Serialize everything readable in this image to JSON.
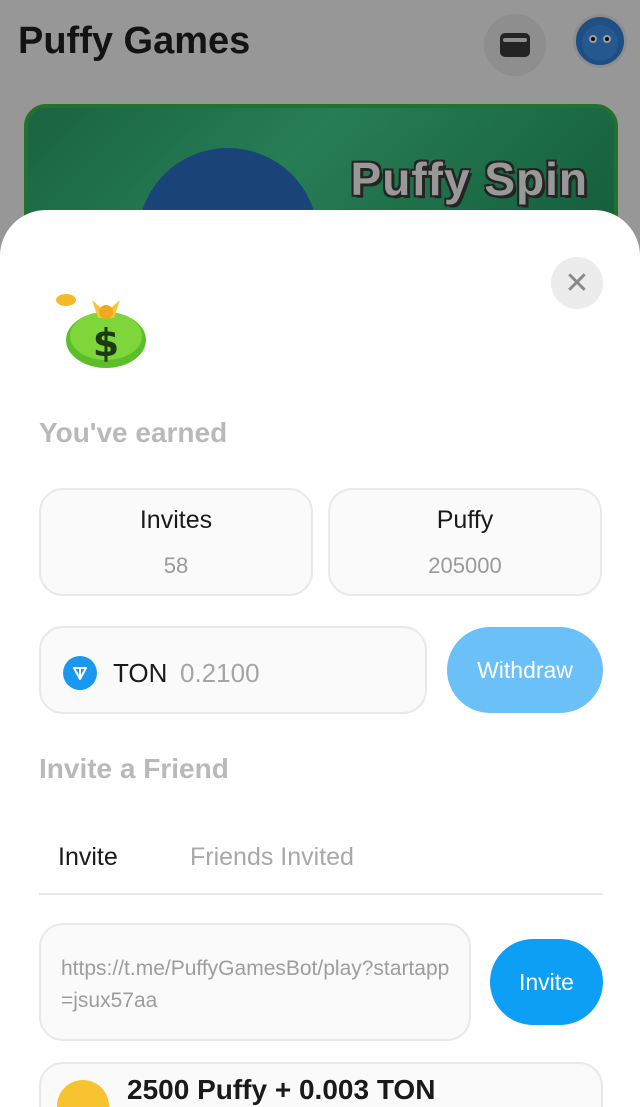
{
  "background_app": {
    "title": "Puffy Games",
    "banner_title": "Puffy Spin"
  },
  "modal": {
    "close_label": "✕",
    "earned_title": "You've earned",
    "stats": [
      {
        "label": "Invites",
        "value": "58"
      },
      {
        "label": "Puffy",
        "value": "205000"
      }
    ],
    "ton": {
      "name": "TON",
      "amount": "0.2100"
    },
    "withdraw_label": "Withdraw",
    "invite_title": "Invite a Friend",
    "tabs": [
      {
        "label": "Invite",
        "active": true
      },
      {
        "label": "Friends Invited",
        "active": false
      }
    ],
    "invite_link": "https://t.me/PuffyGamesBot/play?startapp=jsux57aa",
    "invite_button_label": "Invite",
    "reward_text": "2500 Puffy + 0.003 TON"
  },
  "colors": {
    "accent_blue": "#0d9ef5",
    "withdraw_blue": "#6bc0f7",
    "ton_blue": "#1a98f0",
    "muted_text": "#b9b9b9"
  },
  "icons": {
    "wallet": "wallet-icon",
    "close": "close-icon",
    "money_bag": "money-bag-icon",
    "ton": "ton-icon",
    "reward": "smiley-emoji-icon"
  }
}
